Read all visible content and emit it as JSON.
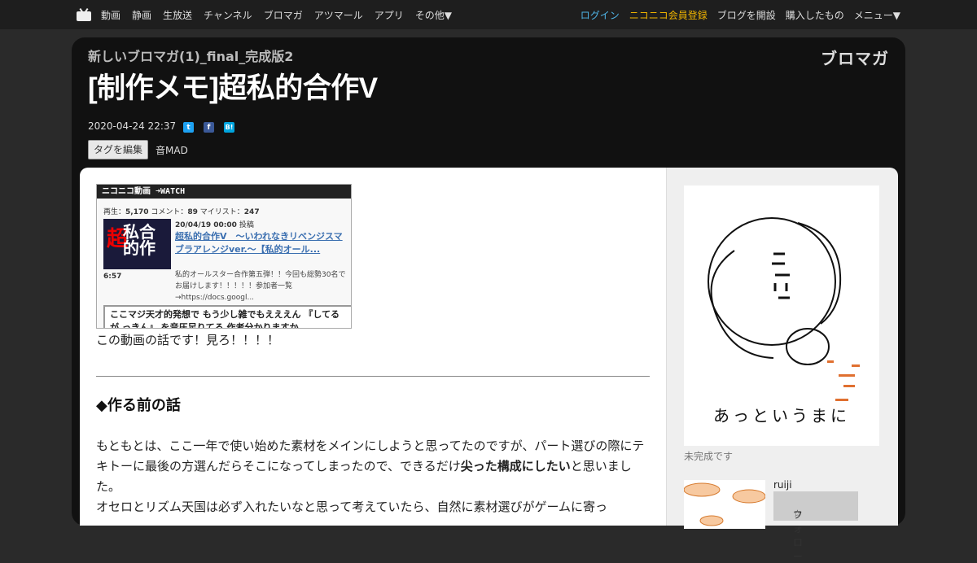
{
  "nav": {
    "left": [
      "動画",
      "静画",
      "生放送",
      "チャンネル",
      "ブロマガ",
      "アツマール",
      "アプリ",
      "その他▼"
    ],
    "login": "ログイン",
    "register": "ニコニコ会員登録",
    "open_blog": "ブログを開設",
    "purchased": "購入したもの",
    "menu": "メニュー▼"
  },
  "header": {
    "blog_name": "新しいブロマガ(1)_final_完成版2",
    "title": "[制作メモ]超私的合作V",
    "logo": "ブロマガ",
    "date": "2020-04-24 22:37",
    "tag_edit": "タグを編集",
    "tag": "音MAD"
  },
  "embed": {
    "bar": "ニコニコ動画 ➜WATCH",
    "stats_prefix_play": "再生：",
    "plays": "5,170",
    "stats_prefix_comment": "コメント：",
    "comments": "89",
    "stats_prefix_mylist": "マイリスト：",
    "mylist": "247",
    "duration": "6:57",
    "post_date": "20/04/19 00:00",
    "posted": "投稿",
    "video_title": "超私的合作Ⅴ　～いわれなきリベンジスマブラアレンジver.～【私的オール...",
    "description": "私的オールスター合作第五弾！！今回も総勢30名でお届けします！！！！！参加者一覧→https://docs.googl...",
    "comment": "ここマジ天才的発想で もう少し雑でもえええん 『してるが っきん』 を音圧足りてる 作者分かりますか"
  },
  "content": {
    "lead": "この動画の話です！見ろ！！！！",
    "heading": "◆作る前の話",
    "paragraph_start": "もともとは、ここ一年で使い始めた素材をメインにしようと思ってたのですが、パート選びの際にテキトーに最後の方選んだらそこになってしまったので、できるだけ",
    "paragraph_bold": "尖った構成にしたい",
    "paragraph_end": "と思いました。",
    "paragraph2": "オセロとリズム天国は必ず入れたいなと思って考えていたら、自然に素材選びがゲームに寄っ"
  },
  "sidebar": {
    "caption": "未完成です",
    "thumb_text": "あっというまに",
    "author": "ruiji",
    "follow": "フォロー"
  }
}
